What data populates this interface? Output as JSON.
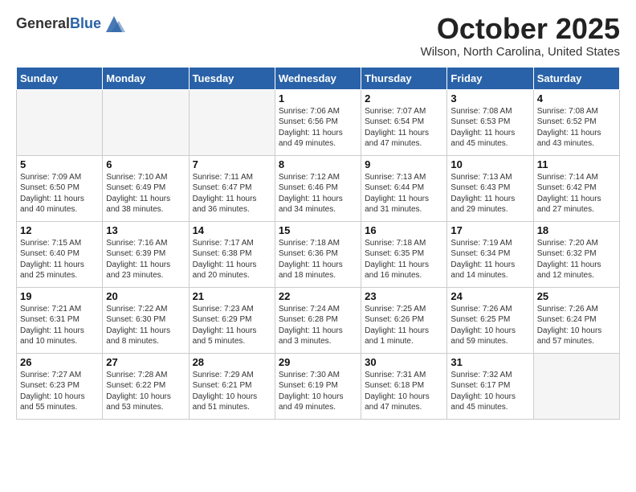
{
  "header": {
    "logo_general": "General",
    "logo_blue": "Blue",
    "month_title": "October 2025",
    "location": "Wilson, North Carolina, United States"
  },
  "weekdays": [
    "Sunday",
    "Monday",
    "Tuesday",
    "Wednesday",
    "Thursday",
    "Friday",
    "Saturday"
  ],
  "weeks": [
    [
      {
        "day": "",
        "info": "",
        "empty": true
      },
      {
        "day": "",
        "info": "",
        "empty": true
      },
      {
        "day": "",
        "info": "",
        "empty": true
      },
      {
        "day": "1",
        "info": "Sunrise: 7:06 AM\nSunset: 6:56 PM\nDaylight: 11 hours\nand 49 minutes.",
        "empty": false
      },
      {
        "day": "2",
        "info": "Sunrise: 7:07 AM\nSunset: 6:54 PM\nDaylight: 11 hours\nand 47 minutes.",
        "empty": false
      },
      {
        "day": "3",
        "info": "Sunrise: 7:08 AM\nSunset: 6:53 PM\nDaylight: 11 hours\nand 45 minutes.",
        "empty": false
      },
      {
        "day": "4",
        "info": "Sunrise: 7:08 AM\nSunset: 6:52 PM\nDaylight: 11 hours\nand 43 minutes.",
        "empty": false
      }
    ],
    [
      {
        "day": "5",
        "info": "Sunrise: 7:09 AM\nSunset: 6:50 PM\nDaylight: 11 hours\nand 40 minutes.",
        "empty": false
      },
      {
        "day": "6",
        "info": "Sunrise: 7:10 AM\nSunset: 6:49 PM\nDaylight: 11 hours\nand 38 minutes.",
        "empty": false
      },
      {
        "day": "7",
        "info": "Sunrise: 7:11 AM\nSunset: 6:47 PM\nDaylight: 11 hours\nand 36 minutes.",
        "empty": false
      },
      {
        "day": "8",
        "info": "Sunrise: 7:12 AM\nSunset: 6:46 PM\nDaylight: 11 hours\nand 34 minutes.",
        "empty": false
      },
      {
        "day": "9",
        "info": "Sunrise: 7:13 AM\nSunset: 6:44 PM\nDaylight: 11 hours\nand 31 minutes.",
        "empty": false
      },
      {
        "day": "10",
        "info": "Sunrise: 7:13 AM\nSunset: 6:43 PM\nDaylight: 11 hours\nand 29 minutes.",
        "empty": false
      },
      {
        "day": "11",
        "info": "Sunrise: 7:14 AM\nSunset: 6:42 PM\nDaylight: 11 hours\nand 27 minutes.",
        "empty": false
      }
    ],
    [
      {
        "day": "12",
        "info": "Sunrise: 7:15 AM\nSunset: 6:40 PM\nDaylight: 11 hours\nand 25 minutes.",
        "empty": false
      },
      {
        "day": "13",
        "info": "Sunrise: 7:16 AM\nSunset: 6:39 PM\nDaylight: 11 hours\nand 23 minutes.",
        "empty": false
      },
      {
        "day": "14",
        "info": "Sunrise: 7:17 AM\nSunset: 6:38 PM\nDaylight: 11 hours\nand 20 minutes.",
        "empty": false
      },
      {
        "day": "15",
        "info": "Sunrise: 7:18 AM\nSunset: 6:36 PM\nDaylight: 11 hours\nand 18 minutes.",
        "empty": false
      },
      {
        "day": "16",
        "info": "Sunrise: 7:18 AM\nSunset: 6:35 PM\nDaylight: 11 hours\nand 16 minutes.",
        "empty": false
      },
      {
        "day": "17",
        "info": "Sunrise: 7:19 AM\nSunset: 6:34 PM\nDaylight: 11 hours\nand 14 minutes.",
        "empty": false
      },
      {
        "day": "18",
        "info": "Sunrise: 7:20 AM\nSunset: 6:32 PM\nDaylight: 11 hours\nand 12 minutes.",
        "empty": false
      }
    ],
    [
      {
        "day": "19",
        "info": "Sunrise: 7:21 AM\nSunset: 6:31 PM\nDaylight: 11 hours\nand 10 minutes.",
        "empty": false
      },
      {
        "day": "20",
        "info": "Sunrise: 7:22 AM\nSunset: 6:30 PM\nDaylight: 11 hours\nand 8 minutes.",
        "empty": false
      },
      {
        "day": "21",
        "info": "Sunrise: 7:23 AM\nSunset: 6:29 PM\nDaylight: 11 hours\nand 5 minutes.",
        "empty": false
      },
      {
        "day": "22",
        "info": "Sunrise: 7:24 AM\nSunset: 6:28 PM\nDaylight: 11 hours\nand 3 minutes.",
        "empty": false
      },
      {
        "day": "23",
        "info": "Sunrise: 7:25 AM\nSunset: 6:26 PM\nDaylight: 11 hours\nand 1 minute.",
        "empty": false
      },
      {
        "day": "24",
        "info": "Sunrise: 7:26 AM\nSunset: 6:25 PM\nDaylight: 10 hours\nand 59 minutes.",
        "empty": false
      },
      {
        "day": "25",
        "info": "Sunrise: 7:26 AM\nSunset: 6:24 PM\nDaylight: 10 hours\nand 57 minutes.",
        "empty": false
      }
    ],
    [
      {
        "day": "26",
        "info": "Sunrise: 7:27 AM\nSunset: 6:23 PM\nDaylight: 10 hours\nand 55 minutes.",
        "empty": false
      },
      {
        "day": "27",
        "info": "Sunrise: 7:28 AM\nSunset: 6:22 PM\nDaylight: 10 hours\nand 53 minutes.",
        "empty": false
      },
      {
        "day": "28",
        "info": "Sunrise: 7:29 AM\nSunset: 6:21 PM\nDaylight: 10 hours\nand 51 minutes.",
        "empty": false
      },
      {
        "day": "29",
        "info": "Sunrise: 7:30 AM\nSunset: 6:19 PM\nDaylight: 10 hours\nand 49 minutes.",
        "empty": false
      },
      {
        "day": "30",
        "info": "Sunrise: 7:31 AM\nSunset: 6:18 PM\nDaylight: 10 hours\nand 47 minutes.",
        "empty": false
      },
      {
        "day": "31",
        "info": "Sunrise: 7:32 AM\nSunset: 6:17 PM\nDaylight: 10 hours\nand 45 minutes.",
        "empty": false
      },
      {
        "day": "",
        "info": "",
        "empty": true
      }
    ]
  ]
}
